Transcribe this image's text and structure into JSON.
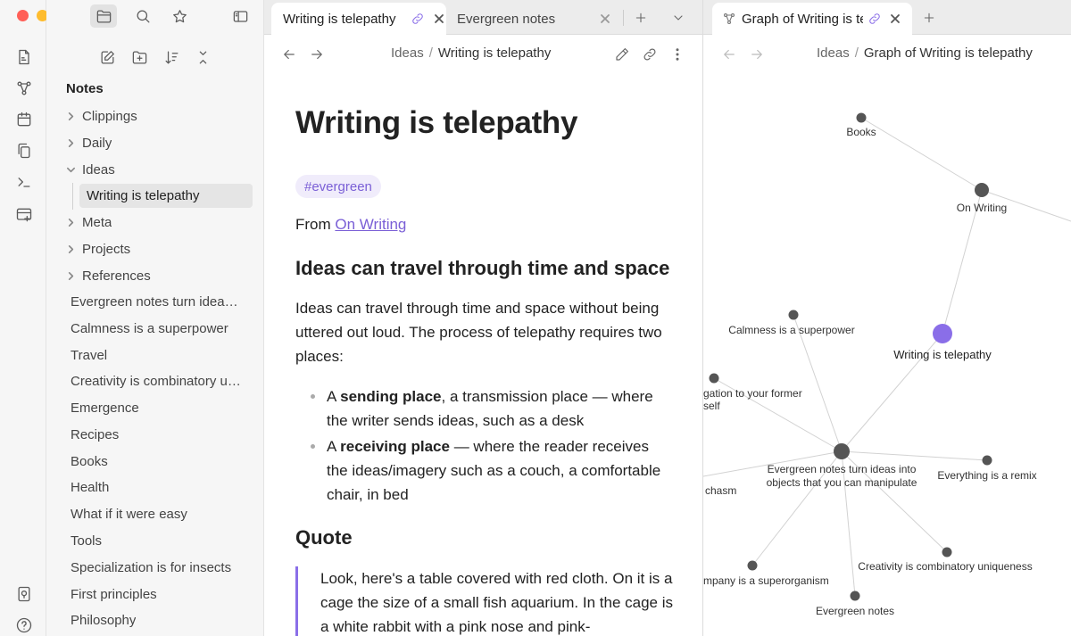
{
  "window": {
    "traffic_lights": [
      "#ff5f57",
      "#febc2e",
      "#28c840"
    ]
  },
  "ribbon": {
    "icons": [
      "page-icon",
      "graph-icon",
      "calendar-icon",
      "copy-icon",
      "terminal-icon",
      "canvas-icon",
      "vault-icon",
      "help-icon"
    ]
  },
  "sidebar": {
    "header_icons": [
      "folder-icon",
      "search-icon",
      "star-icon",
      "sidebar-toggle-icon"
    ],
    "tools": [
      "new-note-icon",
      "new-folder-icon",
      "sort-icon",
      "collapse-icon"
    ],
    "vault_name": "Notes",
    "folders": [
      {
        "label": "Clippings",
        "expanded": false
      },
      {
        "label": "Daily",
        "expanded": false
      },
      {
        "label": "Ideas",
        "expanded": true
      },
      {
        "label": "Meta",
        "expanded": false
      },
      {
        "label": "Projects",
        "expanded": false
      },
      {
        "label": "References",
        "expanded": false
      }
    ],
    "active_child": "Writing is telepathy",
    "files": [
      "Evergreen notes turn ideas into objects that you can manipulate",
      "Calmness is a superpower",
      "Travel",
      "Creativity is combinatory uniqueness",
      "Emergence",
      "Recipes",
      "Books",
      "Health",
      "What if it were easy",
      "Tools",
      "Specialization is for insects",
      "First principles",
      "Philosophy"
    ]
  },
  "tabs_left": [
    {
      "label": "Writing is telepathy",
      "active": true,
      "linked": true
    },
    {
      "label": "Evergreen notes",
      "active": false,
      "linked": false
    }
  ],
  "tabs_right": [
    {
      "label": "Graph of Writing is telepathy",
      "active": true,
      "linked": true
    }
  ],
  "editor": {
    "breadcrumb": {
      "folder": "Ideas",
      "note": "Writing is telepathy"
    },
    "title": "Writing is telepathy",
    "tag": "#evergreen",
    "from_prefix": "From ",
    "from_link": "On Writing",
    "heading1": "Ideas can travel through time and space",
    "paragraph1": "Ideas can travel through time and space without being uttered out loud. The process of telepathy requires two places:",
    "bullets": [
      {
        "prefix": "A ",
        "bold": "sending place",
        "rest": ", a transmission place — where the writer sends ideas, such as a desk"
      },
      {
        "prefix": "A ",
        "bold": "receiving place",
        "rest": " — where the reader receives the ideas/imagery such as a couch, a comfortable chair, in bed"
      }
    ],
    "heading2": "Quote",
    "quote": "Look, here's a table covered with red cloth. On it is a cage the size of a small fish aquarium. In the cage is a white rabbit with a pink nose and pink-"
  },
  "graph": {
    "breadcrumb": {
      "folder": "Ideas",
      "note": "Graph of Writing is telepathy"
    },
    "accent": "#8a6ee8",
    "node_color": "#555555",
    "nodes": [
      {
        "id": "books",
        "label": "Books"
      },
      {
        "id": "onwriting",
        "label": "On Writing"
      },
      {
        "id": "calm",
        "label": "Calmness is a superpower"
      },
      {
        "id": "writing",
        "label": "Writing is telepathy",
        "current": true
      },
      {
        "id": "nav",
        "label": "gation to your former self"
      },
      {
        "id": "evergreen",
        "label": "Evergreen notes turn ideas into objects that you can manipulate"
      },
      {
        "id": "remix",
        "label": "Everything is a remix"
      },
      {
        "id": "chasm",
        "label": "chasm"
      },
      {
        "id": "superorg",
        "label": "mpany is a superorganism"
      },
      {
        "id": "creativity",
        "label": "Creativity is combinatory uniqueness"
      },
      {
        "id": "evnotes",
        "label": "Evergreen notes"
      }
    ]
  }
}
